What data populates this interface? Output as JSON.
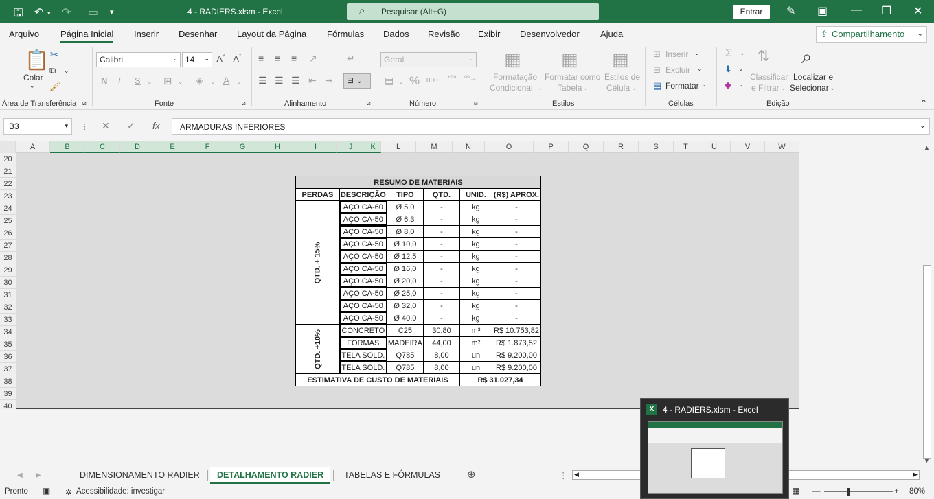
{
  "title_bar": {
    "document_title": "4 - RADIERS.xlsm  -  Excel",
    "search_placeholder": "Pesquisar (Alt+G)",
    "sign_in": "Entrar"
  },
  "menu": {
    "tabs": [
      "Arquivo",
      "Página Inicial",
      "Inserir",
      "Desenhar",
      "Layout da Página",
      "Fórmulas",
      "Dados",
      "Revisão",
      "Exibir",
      "Desenvolvedor",
      "Ajuda"
    ],
    "active_tab": "Página Inicial",
    "share": "Compartilhamento"
  },
  "ribbon": {
    "clipboard": {
      "label": "Área de Transferência",
      "paste": "Colar"
    },
    "font": {
      "label": "Fonte",
      "family": "Calibri",
      "size": "14"
    },
    "alignment": {
      "label": "Alinhamento"
    },
    "number": {
      "label": "Número",
      "format": "Geral"
    },
    "styles": {
      "label": "Estilos",
      "conditional_1": "Formatação",
      "conditional_2": "Condicional",
      "table_1": "Formatar como",
      "table_2": "Tabela",
      "cell_1": "Estilos de",
      "cell_2": "Célula"
    },
    "cells": {
      "label": "Células",
      "insert": "Inserir",
      "delete": "Excluir",
      "format": "Formatar"
    },
    "editing": {
      "label": "Edição",
      "sort_1": "Classificar",
      "sort_2": "e Filtrar",
      "find_1": "Localizar e",
      "find_2": "Selecionar"
    }
  },
  "formula_bar": {
    "name_box": "B3",
    "fx": "fx",
    "content": "ARMADURAS INFERIORES"
  },
  "grid": {
    "columns": [
      "A",
      "B",
      "C",
      "D",
      "E",
      "F",
      "G",
      "H",
      "I",
      "J",
      "K",
      "L",
      "M",
      "N",
      "O",
      "P",
      "Q",
      "R",
      "S",
      "T",
      "U",
      "V",
      "W"
    ],
    "rows": [
      "20",
      "21",
      "22",
      "23",
      "24",
      "25",
      "26",
      "27",
      "28",
      "29",
      "30",
      "31",
      "32",
      "33",
      "34",
      "35",
      "36",
      "37",
      "38",
      "39",
      "40"
    ]
  },
  "materials": {
    "title": "RESUMO DE MATERIAIS",
    "headers": [
      "PERDAS",
      "DESCRIÇÃO",
      "TIPO",
      "QTD.",
      "UNID.",
      "(R$) APROX."
    ],
    "group1_label": "QTD. + 15%",
    "group1": [
      [
        "AÇO CA-60",
        "Ø 5,0",
        "-",
        "kg",
        "-"
      ],
      [
        "AÇO CA-50",
        "Ø 6,3",
        "-",
        "kg",
        "-"
      ],
      [
        "AÇO CA-50",
        "Ø 8,0",
        "-",
        "kg",
        "-"
      ],
      [
        "AÇO CA-50",
        "Ø 10,0",
        "-",
        "kg",
        "-"
      ],
      [
        "AÇO CA-50",
        "Ø 12,5",
        "-",
        "kg",
        "-"
      ],
      [
        "AÇO CA-50",
        "Ø 16,0",
        "-",
        "kg",
        "-"
      ],
      [
        "AÇO CA-50",
        "Ø 20,0",
        "-",
        "kg",
        "-"
      ],
      [
        "AÇO CA-50",
        "Ø 25,0",
        "-",
        "kg",
        "-"
      ],
      [
        "AÇO CA-50",
        "Ø 32,0",
        "-",
        "kg",
        "-"
      ],
      [
        "AÇO CA-50",
        "Ø 40,0",
        "-",
        "kg",
        "-"
      ]
    ],
    "group2_label": "QTD. +10%",
    "group2": [
      [
        "CONCRETO",
        "C25",
        "30,80",
        "m³",
        "R$ 10.753,82"
      ],
      [
        "FORMAS",
        "MADEIRA",
        "44,00",
        "m²",
        "R$ 1.873,52"
      ],
      [
        "TELA SOLD.",
        "Q785",
        "8,00",
        "un",
        "R$ 9.200,00"
      ],
      [
        "TELA SOLD.",
        "Q785",
        "8,00",
        "un",
        "R$ 9.200,00"
      ]
    ],
    "total_label": "ESTIMATIVA DE CUSTO DE MATERIAIS",
    "total_value": "R$ 31.027,34"
  },
  "sheet_tabs": [
    "DIMENSIONAMENTO RADIER",
    "DETALHAMENTO RADIER",
    "TABELAS E FÓRMULAS"
  ],
  "active_sheet": "DETALHAMENTO RADIER",
  "status": {
    "ready": "Pronto",
    "accessibility": "Acessibilidade: investigar",
    "zoom": "80%"
  },
  "taskbar_preview": {
    "title": "4 - RADIERS.xlsm - Excel",
    "app_letter": "X"
  },
  "colors": {
    "accent": "#217346",
    "search_bg": "#c6e0cf"
  }
}
